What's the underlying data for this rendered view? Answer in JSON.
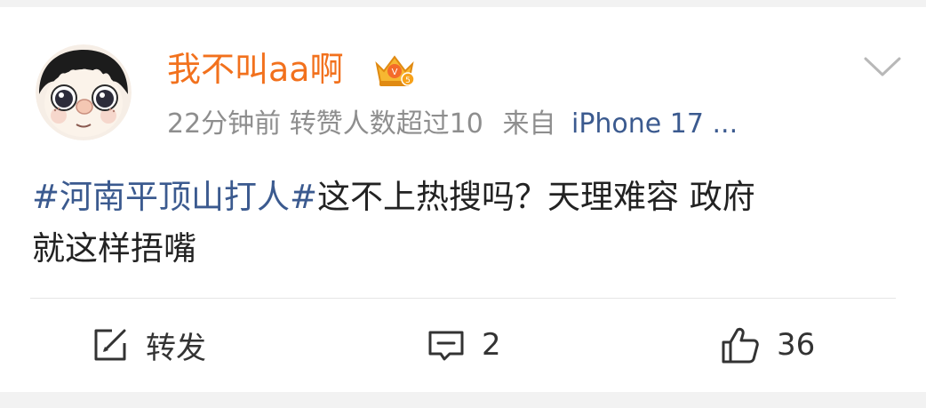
{
  "post": {
    "username": "我不叫aa啊",
    "meta_time_and_stats": "22分钟前 转赞人数超过10",
    "meta_source_prefix": "来自",
    "meta_source_device": "iPhone 17 ...",
    "hashtag": "#河南平顶山打人#",
    "text_line1": "这不上热搜吗？天理难容 政府",
    "text_line2": "就这样捂嘴"
  },
  "actions": {
    "repost_label": "转发",
    "comment_count": "2",
    "like_count": "36"
  },
  "icons": {
    "avatar": "cartoon-face-avatar",
    "badge": "vip-crown-badge-icon",
    "more": "chevron-down-icon",
    "repost": "repost-icon",
    "comment": "comment-icon",
    "like": "thumbs-up-icon"
  },
  "colors": {
    "username": "#f2711d",
    "hashtag": "#3b5a8f",
    "meta_gray": "#8e8e8e",
    "text": "#222222"
  }
}
